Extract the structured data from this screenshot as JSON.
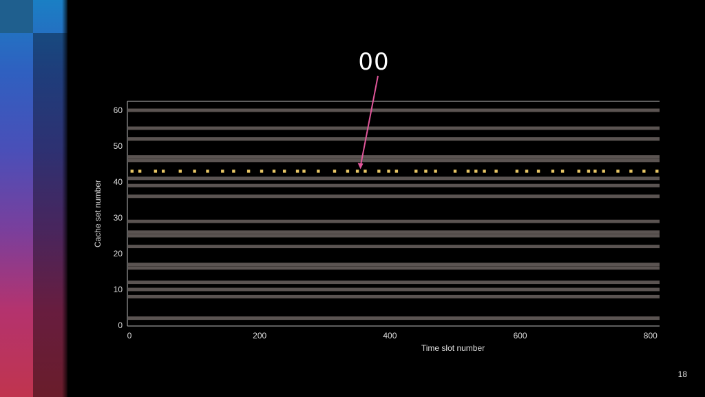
{
  "slide": {
    "title": "00",
    "page_number": "18"
  },
  "colors": {
    "background": "#000000",
    "band": "#6b6360",
    "highlight": "#e8c766",
    "arrow": "#e0569a",
    "text": "#dddddd"
  },
  "chart_data": {
    "type": "heatmap",
    "title": "",
    "xlabel": "Time slot number",
    "ylabel": "Cache set number",
    "xlim": [
      0,
      815
    ],
    "ylim": [
      0,
      63
    ],
    "xticks": [
      0,
      200,
      400,
      600,
      800
    ],
    "yticks": [
      0,
      10,
      20,
      30,
      40,
      50,
      60
    ],
    "grid": false,
    "active_cache_sets": [
      2,
      8,
      10,
      12,
      16,
      17,
      22,
      25,
      26,
      29,
      36,
      39,
      41,
      46,
      47,
      52,
      55,
      60
    ],
    "highlighted_cache_set": {
      "set": 43,
      "time_slots": [
        4,
        16,
        40,
        52,
        78,
        100,
        120,
        143,
        160,
        183,
        203,
        222,
        238,
        258,
        268,
        290,
        315,
        335,
        350,
        362,
        383,
        398,
        410,
        440,
        455,
        470,
        500,
        520,
        532,
        545,
        563,
        595,
        610,
        628,
        650,
        665,
        690,
        705,
        715,
        728,
        750,
        770,
        790,
        810
      ],
      "annotation": "00",
      "annotation_time_slot": 360
    }
  }
}
